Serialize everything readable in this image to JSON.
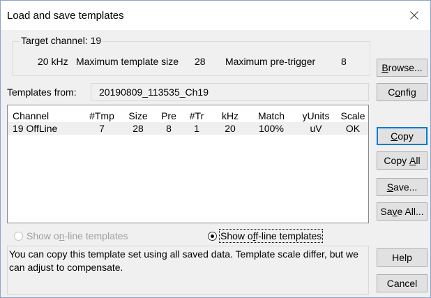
{
  "window": {
    "title": "Load and save templates",
    "close_glyph": "✕"
  },
  "target": {
    "legend": "Target channel: 19",
    "khz": "20 kHz",
    "max_template_label": "Maximum template size",
    "max_template_value": "28",
    "max_pretrigger_label": "Maximum pre-trigger",
    "max_pretrigger_value": "8"
  },
  "templates_from": {
    "label": "Templates from:",
    "value": "20190809_113535_Ch19"
  },
  "table": {
    "columns": [
      "Channel",
      "#Tmp",
      "Size",
      "Pre",
      "#Tr",
      "kHz",
      "Match",
      "yUnits",
      "Scale"
    ],
    "rows": [
      [
        "19 OffLine",
        "7",
        "28",
        "8",
        "1",
        "20",
        "100%",
        "uV",
        "OK"
      ]
    ]
  },
  "buttons": {
    "browse": {
      "pre": "",
      "key": "B",
      "post": "rowse..."
    },
    "config": {
      "pre": "C",
      "key": "o",
      "post": "nfig"
    },
    "copy": {
      "pre": "",
      "key": "C",
      "post": "opy"
    },
    "copy_all": {
      "pre": "Copy ",
      "key": "A",
      "post": "ll"
    },
    "save": {
      "pre": "",
      "key": "S",
      "post": "ave..."
    },
    "save_all": {
      "pre": "Sa",
      "key": "v",
      "post": "e All..."
    },
    "help": "Help",
    "cancel": "Cancel"
  },
  "radios": {
    "online": {
      "pre": "Show o",
      "key": "n",
      "post": "-line templates",
      "checked": false,
      "enabled": false
    },
    "offline": {
      "pre": "Show o",
      "key": "f",
      "post": "f-line templates",
      "checked": true,
      "enabled": true
    }
  },
  "message": "You can copy this template set using all saved data. Template scale differ, but we can adjust to compensate.",
  "colors": {
    "accent": "#0078d7",
    "dialog_bg": "#f0f0f0"
  }
}
